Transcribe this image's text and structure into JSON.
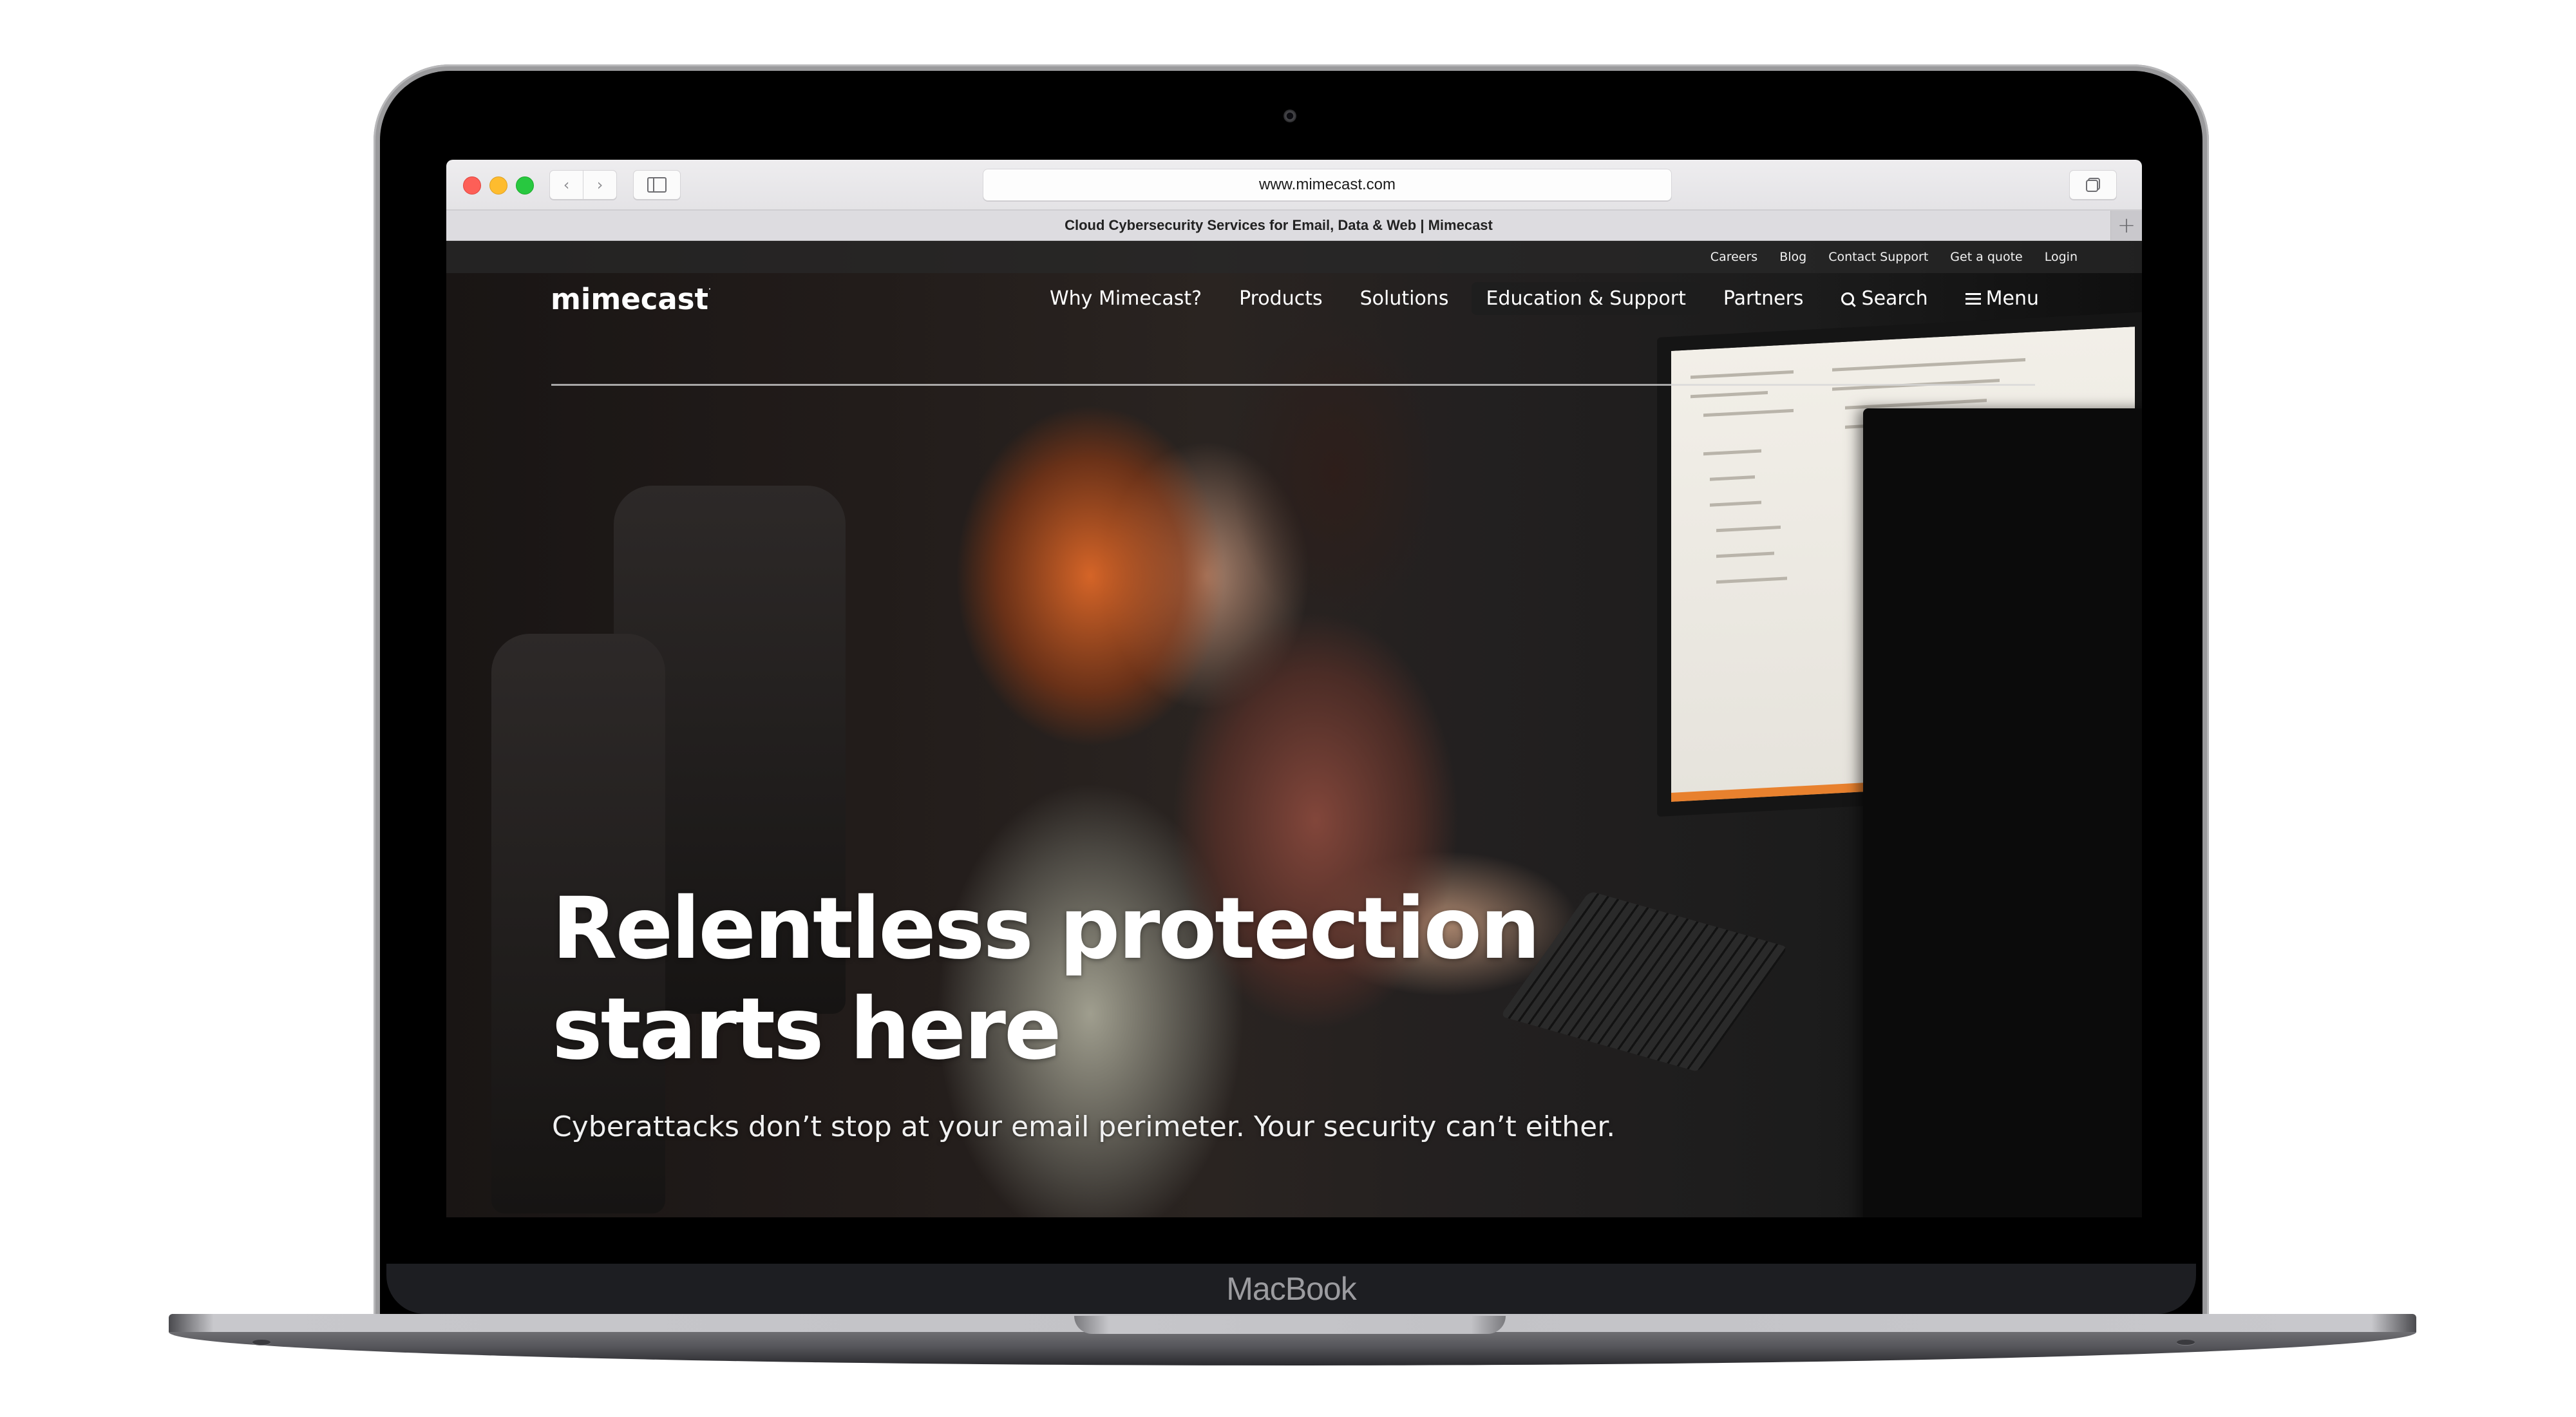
{
  "device": {
    "label": "MacBook"
  },
  "browser": {
    "address_bar": "www.mimecast.com",
    "tab_title": "Cloud Cybersecurity Services for Email, Data & Web | Mimecast",
    "back_icon": "‹",
    "forward_icon": "›",
    "new_tab_icon": "+"
  },
  "site": {
    "logo": "mimecast",
    "logo_mark": "·",
    "utility_nav": [
      "Careers",
      "Blog",
      "Contact Support",
      "Get a quote",
      "Login"
    ],
    "main_nav": [
      {
        "label": "Why Mimecast?",
        "active": false
      },
      {
        "label": "Products",
        "active": false
      },
      {
        "label": "Solutions",
        "active": false
      },
      {
        "label": "Education & Support",
        "active": true
      },
      {
        "label": "Partners",
        "active": false
      }
    ],
    "search_label": "Search",
    "menu_label": "Menu",
    "hero": {
      "title_line1": "Relentless protection",
      "title_line2": "starts here",
      "subtitle": "Cyberattacks don’t stop at your email perimeter. Your security can’t either."
    }
  },
  "colors": {
    "traffic_close": "#fd5f57",
    "traffic_minimize": "#febc2e",
    "traffic_maximize": "#28c840",
    "hero_text": "#ffffff",
    "active_nav_bg": "#1e1e1e"
  }
}
